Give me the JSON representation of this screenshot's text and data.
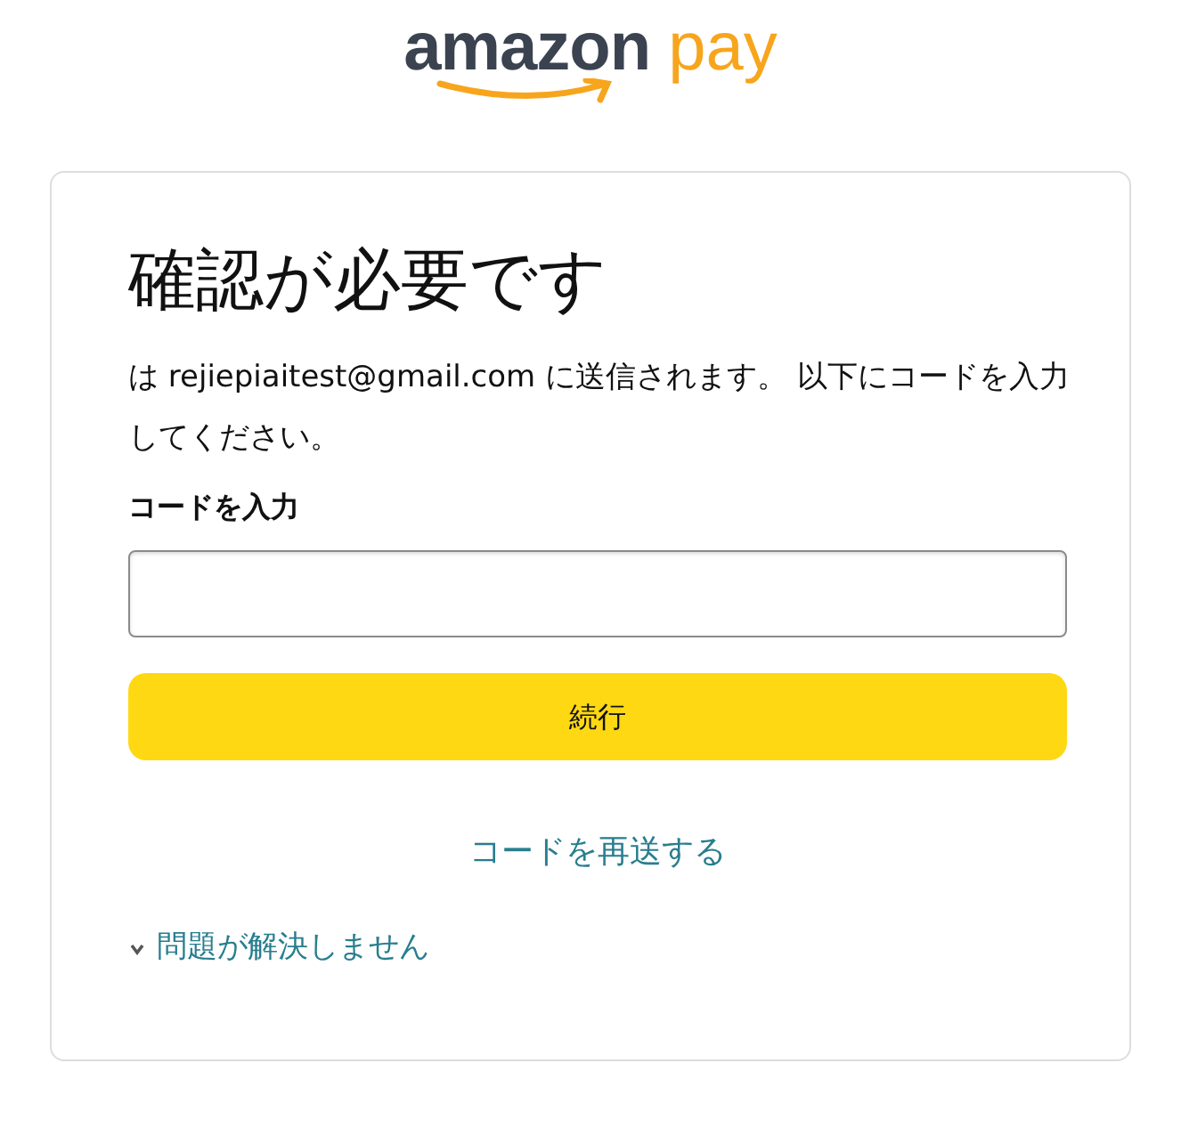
{
  "logo": {
    "wordmark": "amazon",
    "product": "pay"
  },
  "card": {
    "title": "確認が必要です",
    "message": "は rejiepiaitest@gmail.com に送信されます。 以下にコードを入力してください。",
    "code_field": {
      "label": "コードを入力"
    },
    "continue_button": "続行",
    "resend_link": "コードを再送する",
    "help_toggle": {
      "label": "問題が解決しません",
      "expanded": false
    }
  }
}
